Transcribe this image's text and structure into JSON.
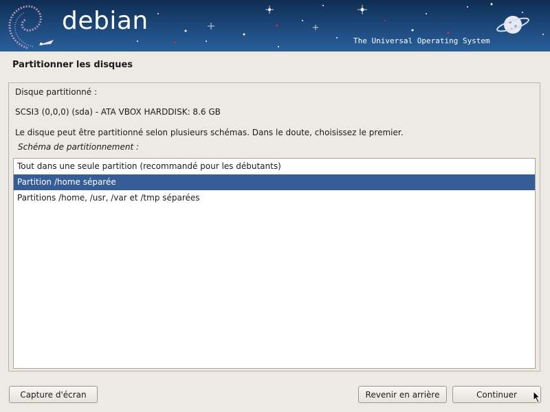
{
  "banner": {
    "logo": "debian",
    "tagline": "The Universal Operating System"
  },
  "page": {
    "title": "Partitionner les disques"
  },
  "content": {
    "disk_label": "Disque partitionné :",
    "disk_name": "SCSI3 (0,0,0) (sda) - ATA VBOX HARDDISK: 8.6 GB",
    "description": "Le disque peut être partitionné selon plusieurs schémas. Dans le doute, choisissez le premier.",
    "list_label": "Schéma de partitionnement :",
    "options": [
      {
        "label": "Tout dans une seule partition (recommandé pour les débutants)",
        "selected": false
      },
      {
        "label": "Partition /home séparée",
        "selected": true
      },
      {
        "label": "Partitions /home, /usr, /var et /tmp séparées",
        "selected": false
      }
    ]
  },
  "buttons": {
    "screenshot": "Capture d'écran",
    "back": "Revenir en arrière",
    "continue": "Continuer"
  },
  "colors": {
    "selection": "#365d96",
    "banner": "#1d4a7e",
    "background": "#edeae4"
  }
}
